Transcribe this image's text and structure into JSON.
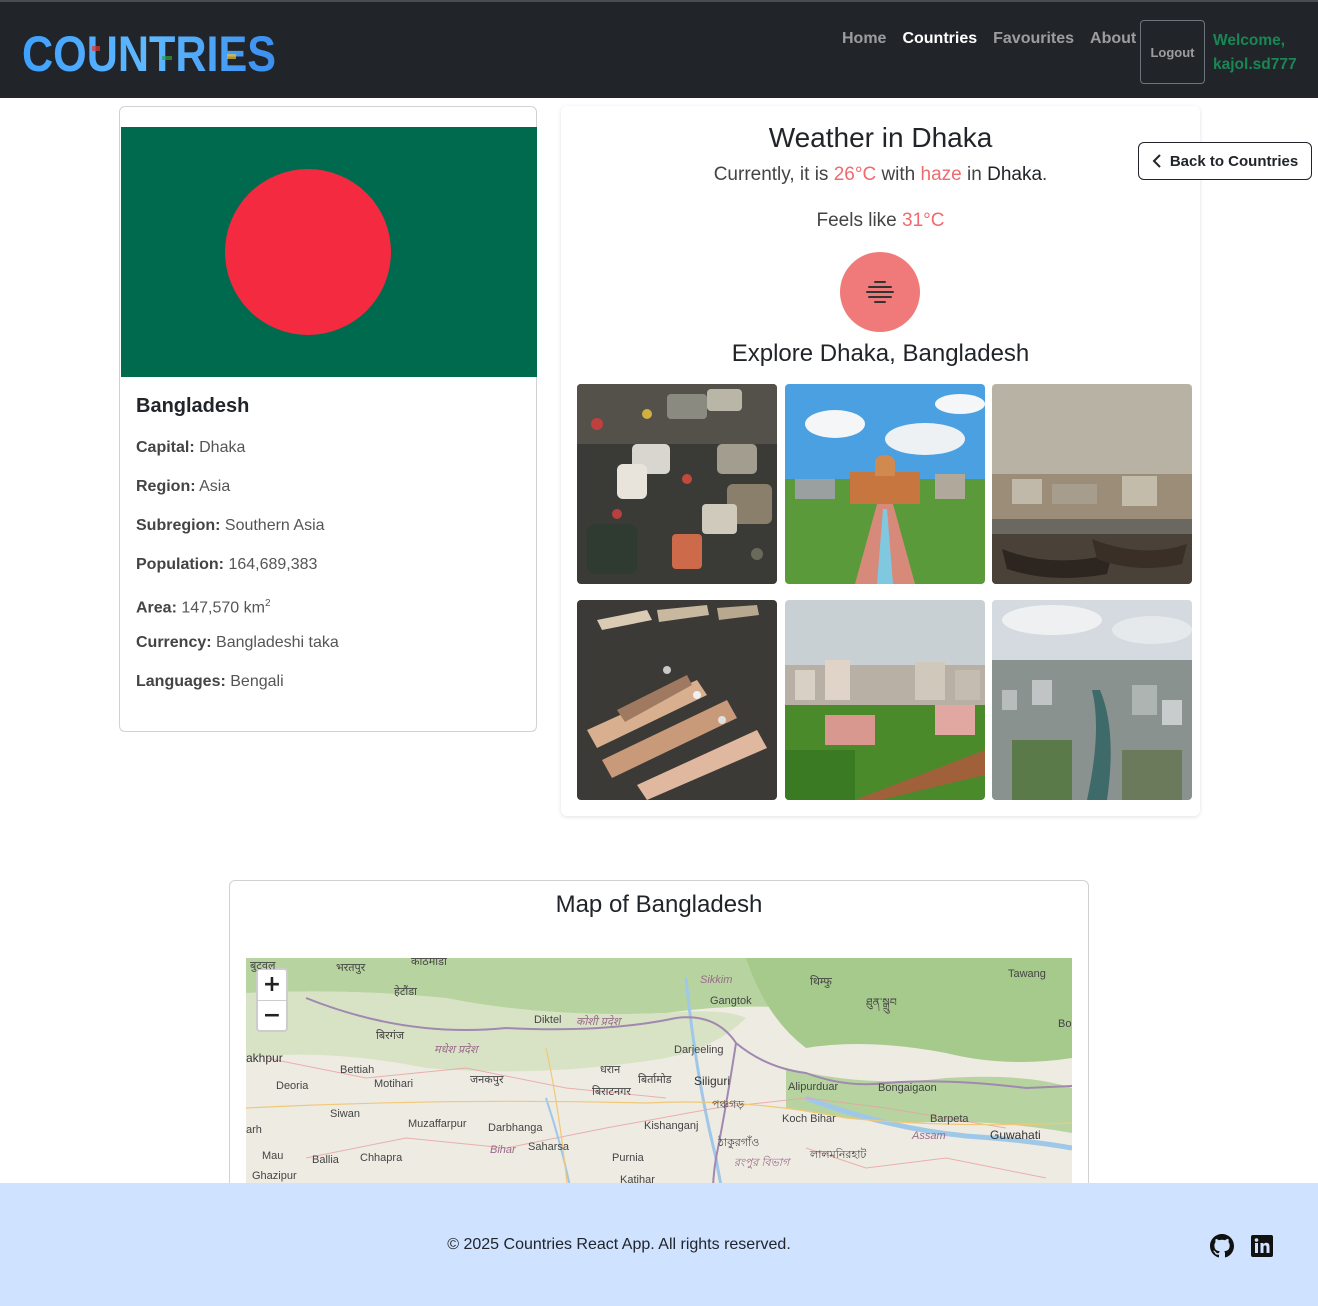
{
  "brand": {
    "name": "COUNTRIES"
  },
  "nav": {
    "links": [
      {
        "label": "Home",
        "active": false
      },
      {
        "label": "Countries",
        "active": true
      },
      {
        "label": "Favourites",
        "active": false
      },
      {
        "label": "About",
        "active": false
      }
    ],
    "logout_label": "Logout",
    "welcome_line1": "Welcome,",
    "welcome_line2": "kajol.sd777"
  },
  "country": {
    "name": "Bangladesh",
    "flag_colors": {
      "field": "#006a4e",
      "disc": "#f42a41"
    },
    "facts": [
      {
        "label": "Capital:",
        "value": "Dhaka"
      },
      {
        "label": "Region:",
        "value": "Asia"
      },
      {
        "label": "Subregion:",
        "value": "Southern Asia"
      },
      {
        "label": "Population:",
        "value": "164,689,383"
      },
      {
        "label": "Area:",
        "value": "147,570 km",
        "sup": "2"
      },
      {
        "label": "Currency:",
        "value": "Bangladeshi taka"
      },
      {
        "label": "Languages:",
        "value": "Bengali"
      }
    ]
  },
  "weather": {
    "title": "Weather in Dhaka",
    "line_prefix": "Currently, it is",
    "temperature": "26°C",
    "line_mid": "with",
    "condition": "haze",
    "line_in": "in",
    "city": "Dhaka",
    "line_end": ".",
    "feels_prefix": "Feels like",
    "feels_value": "31°C",
    "icon": "haze-icon",
    "accent_color": "#ef6b70"
  },
  "explore": {
    "title": "Explore Dhaka, Bangladesh",
    "photos": [
      {
        "name": "photo-traffic"
      },
      {
        "name": "photo-lalbagh-fort"
      },
      {
        "name": "photo-river-port"
      },
      {
        "name": "photo-boats"
      },
      {
        "name": "photo-fort-aerial"
      },
      {
        "name": "photo-city-aerial"
      }
    ]
  },
  "back_button": {
    "label": "Back to Countries",
    "icon": "chevron-left-icon"
  },
  "map": {
    "title": "Map of Bangladesh",
    "zoom_in": "+",
    "zoom_out": "−",
    "labels": [
      "बुटवल",
      "भरतपुर",
      "काठमाडौं",
      "हेटौंडा",
      "Sikkim",
      "Gangtok",
      "थिम्फु",
      "Tawang",
      "ཐུན་སྒྲུབ",
      "Bo",
      "Diktel",
      "कोशी प्रदेश",
      "बिरगंज",
      "मधेश प्रदेश",
      "Darjeeling",
      "akhpur",
      "Bettiah",
      "धरान",
      "जनकपुर",
      "बिर्तामोड",
      "Siliguri",
      "Alipurduar",
      "Bongaigaon",
      "Deoria",
      "Motihari",
      "बिराटनगर",
      "পঞ্চগড়",
      "Siwan",
      "Koch Bihar",
      "Barpeta",
      "arh",
      "Muzaffarpur",
      "Darbhanga",
      "Kishanganj",
      "Assam",
      "Guwahati",
      "ঠাকুরগাঁও",
      "Mau",
      "Ballia",
      "Chhapra",
      "Bihar",
      "Saharsa",
      "Purnia",
      "রংপুর বিভাগ",
      "লালমনিরহাট",
      "Ghazipur",
      "Katihar"
    ]
  },
  "footer": {
    "text": "© 2025 Countries React App. All rights reserved.",
    "background": "#cfe2ff",
    "icons": [
      "github-icon",
      "linkedin-icon"
    ]
  }
}
